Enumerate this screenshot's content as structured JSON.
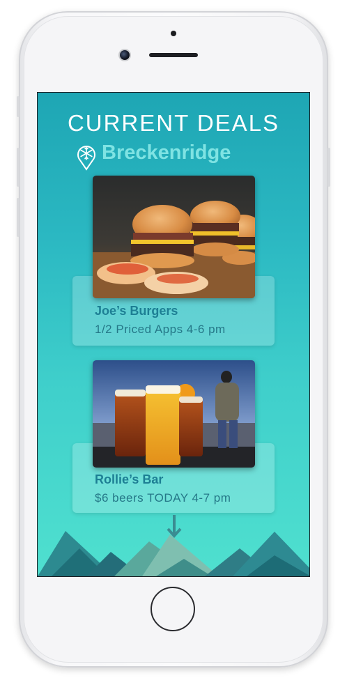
{
  "header": {
    "title": "CURRENT DEALS",
    "location": "Breckenridge"
  },
  "deals": [
    {
      "name": "Joe’s Burgers",
      "description": "1/2 Priced Apps 4-6 pm",
      "photo": "burgers-photo"
    },
    {
      "name": "Rollie’s Bar",
      "description": "$6 beers TODAY 4-7 pm",
      "photo": "beers-photo"
    }
  ],
  "colors": {
    "screen_top": "#1ea6b4",
    "screen_bottom": "#4fe0cf",
    "location_text": "#7fe3e3",
    "deal_name": "#1d7f94"
  },
  "icons": [
    "snowflake-location-pin-icon",
    "scroll-down-arrow-icon"
  ]
}
